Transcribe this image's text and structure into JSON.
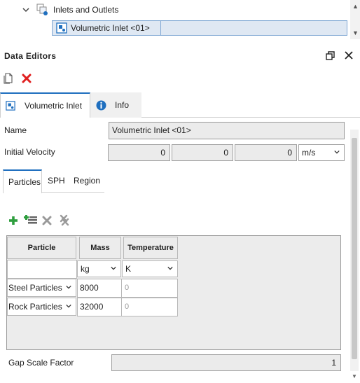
{
  "tree": {
    "parent_label": "Inlets and Outlets",
    "selected_label": "Volumetric Inlet <01>"
  },
  "panel": {
    "title": "Data Editors",
    "restore_icon": "restore-window-icon",
    "close_icon": "close-icon"
  },
  "toolbar": {
    "copy_icon": "copy-icon",
    "delete_icon": "delete-red-x-icon"
  },
  "tabs": [
    {
      "label": "Volumetric Inlet",
      "icon": "volumetric-inlet-icon"
    },
    {
      "label": "Info",
      "icon": "info-icon"
    }
  ],
  "form": {
    "name_label": "Name",
    "name_value": "Volumetric Inlet <01>",
    "velocity_label": "Initial Velocity",
    "velocity": [
      "0",
      "0",
      "0"
    ],
    "velocity_unit": "m/s",
    "gap_label": "Gap Scale Factor",
    "gap_value": "1"
  },
  "subtabs": [
    "Particles",
    "SPH",
    "Region"
  ],
  "grid_toolbar": [
    "add-icon",
    "add-list-icon",
    "remove-icon",
    "remove-all-icon"
  ],
  "table": {
    "headers": [
      "Particle",
      "Mass",
      "Temperature"
    ],
    "units": [
      "",
      "kg",
      "K"
    ],
    "rows": [
      {
        "particle": "Steel Particles",
        "mass": "8000",
        "temperature": "0"
      },
      {
        "particle": "Rock Particles",
        "mass": "32000",
        "temperature": "0"
      }
    ]
  },
  "colors": {
    "accent_blue": "#1f6fbf",
    "delete_red": "#e02020",
    "add_green": "#2e9e3e",
    "selection_bg": "#dfe8f3"
  }
}
